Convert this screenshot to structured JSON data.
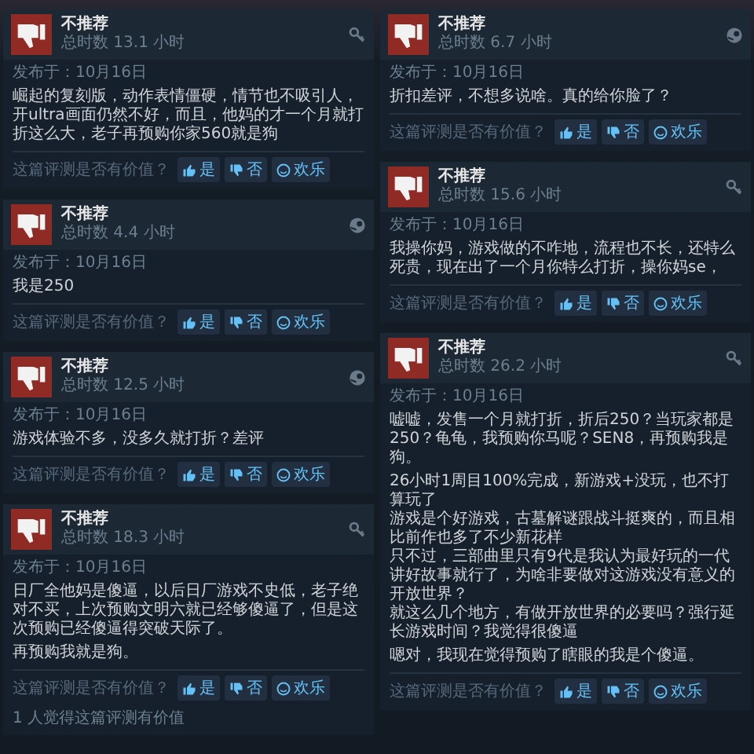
{
  "columns": [
    {
      "reviews": [
        {
          "verdict": "不推荐",
          "playtime": "总时数 13.1 小时",
          "kind": "key",
          "posted": "发布于：10月16日",
          "paragraphs": [
            [
              "崛起的复刻版，动作表情僵硬，情节也不吸引人，开ultra画面仍然不好，而且，他妈的才一个月就打折这么大，老子再预购你家560就是狗"
            ]
          ],
          "question": "这篇评测是否有价值？",
          "votes": [
            "是",
            "否",
            "欢乐"
          ]
        },
        {
          "verdict": "不推荐",
          "playtime": "总时数 4.4 小时",
          "kind": "circle",
          "posted": "发布于：10月16日",
          "paragraphs": [
            [
              "我是250"
            ]
          ],
          "question": "这篇评测是否有价值？",
          "votes": [
            "是",
            "否",
            "欢乐"
          ]
        },
        {
          "verdict": "不推荐",
          "playtime": "总时数 12.5 小时",
          "kind": "circle",
          "posted": "发布于：10月16日",
          "paragraphs": [
            [
              "游戏体验不多，没多久就打折？差评"
            ]
          ],
          "question": "这篇评测是否有价值？",
          "votes": [
            "是",
            "否",
            "欢乐"
          ]
        },
        {
          "verdict": "不推荐",
          "playtime": "总时数 18.3 小时",
          "kind": "key",
          "posted": "发布于：10月16日",
          "paragraphs": [
            [
              "日厂全他妈是傻逼，以后日厂游戏不史低，老子绝对不买，上次预购文明六就已经够傻逼了，但是这次预购已经傻逼得突破天际了。"
            ],
            [
              "再预购我就是狗。"
            ]
          ],
          "question": "这篇评测是否有价值？",
          "votes": [
            "是",
            "否",
            "欢乐"
          ],
          "helpful": "1 人觉得这篇评测有价值"
        }
      ]
    },
    {
      "reviews": [
        {
          "verdict": "不推荐",
          "playtime": "总时数 6.7 小时",
          "kind": "circle",
          "posted": "发布于：10月16日",
          "paragraphs": [
            [
              "折扣差评，不想多说啥。真的给你脸了？"
            ]
          ],
          "question": "这篇评测是否有价值？",
          "votes": [
            "是",
            "否",
            "欢乐"
          ]
        },
        {
          "verdict": "不推荐",
          "playtime": "总时数 15.6 小时",
          "kind": "key",
          "posted": "发布于：10月16日",
          "paragraphs": [
            [
              "我操你妈，游戏做的不咋地，流程也不长，还特么死贵，现在出了一个月你特么打折，操你妈se，"
            ]
          ],
          "question": "这篇评测是否有价值？",
          "votes": [
            "是",
            "否",
            "欢乐"
          ]
        },
        {
          "verdict": "不推荐",
          "playtime": "总时数 26.2 小时",
          "kind": "key",
          "posted": "发布于：10月16日",
          "paragraphs": [
            [
              "嘘嘘，发售一个月就打折，折后250？当玩家都是250？龟龟，我预购你马呢？SEN8，再预购我是狗。"
            ],
            [
              "26小时1周目100%完成，新游戏+没玩，也不打算玩了",
              "游戏是个好游戏，古墓解谜跟战斗挺爽的，而且相比前作也多了不少新花样",
              "只不过，三部曲里只有9代是我认为最好玩的一代",
              "讲好故事就行了，为啥非要做对这游戏没有意义的开放世界？",
              "就这么几个地方，有做开放世界的必要吗？强行延长游戏时间？我觉得很傻逼"
            ],
            [
              "嗯对，我现在觉得预购了瞎眼的我是个傻逼。"
            ]
          ],
          "question": "这篇评测是否有价值？",
          "votes": [
            "是",
            "否",
            "欢乐"
          ]
        }
      ]
    }
  ]
}
